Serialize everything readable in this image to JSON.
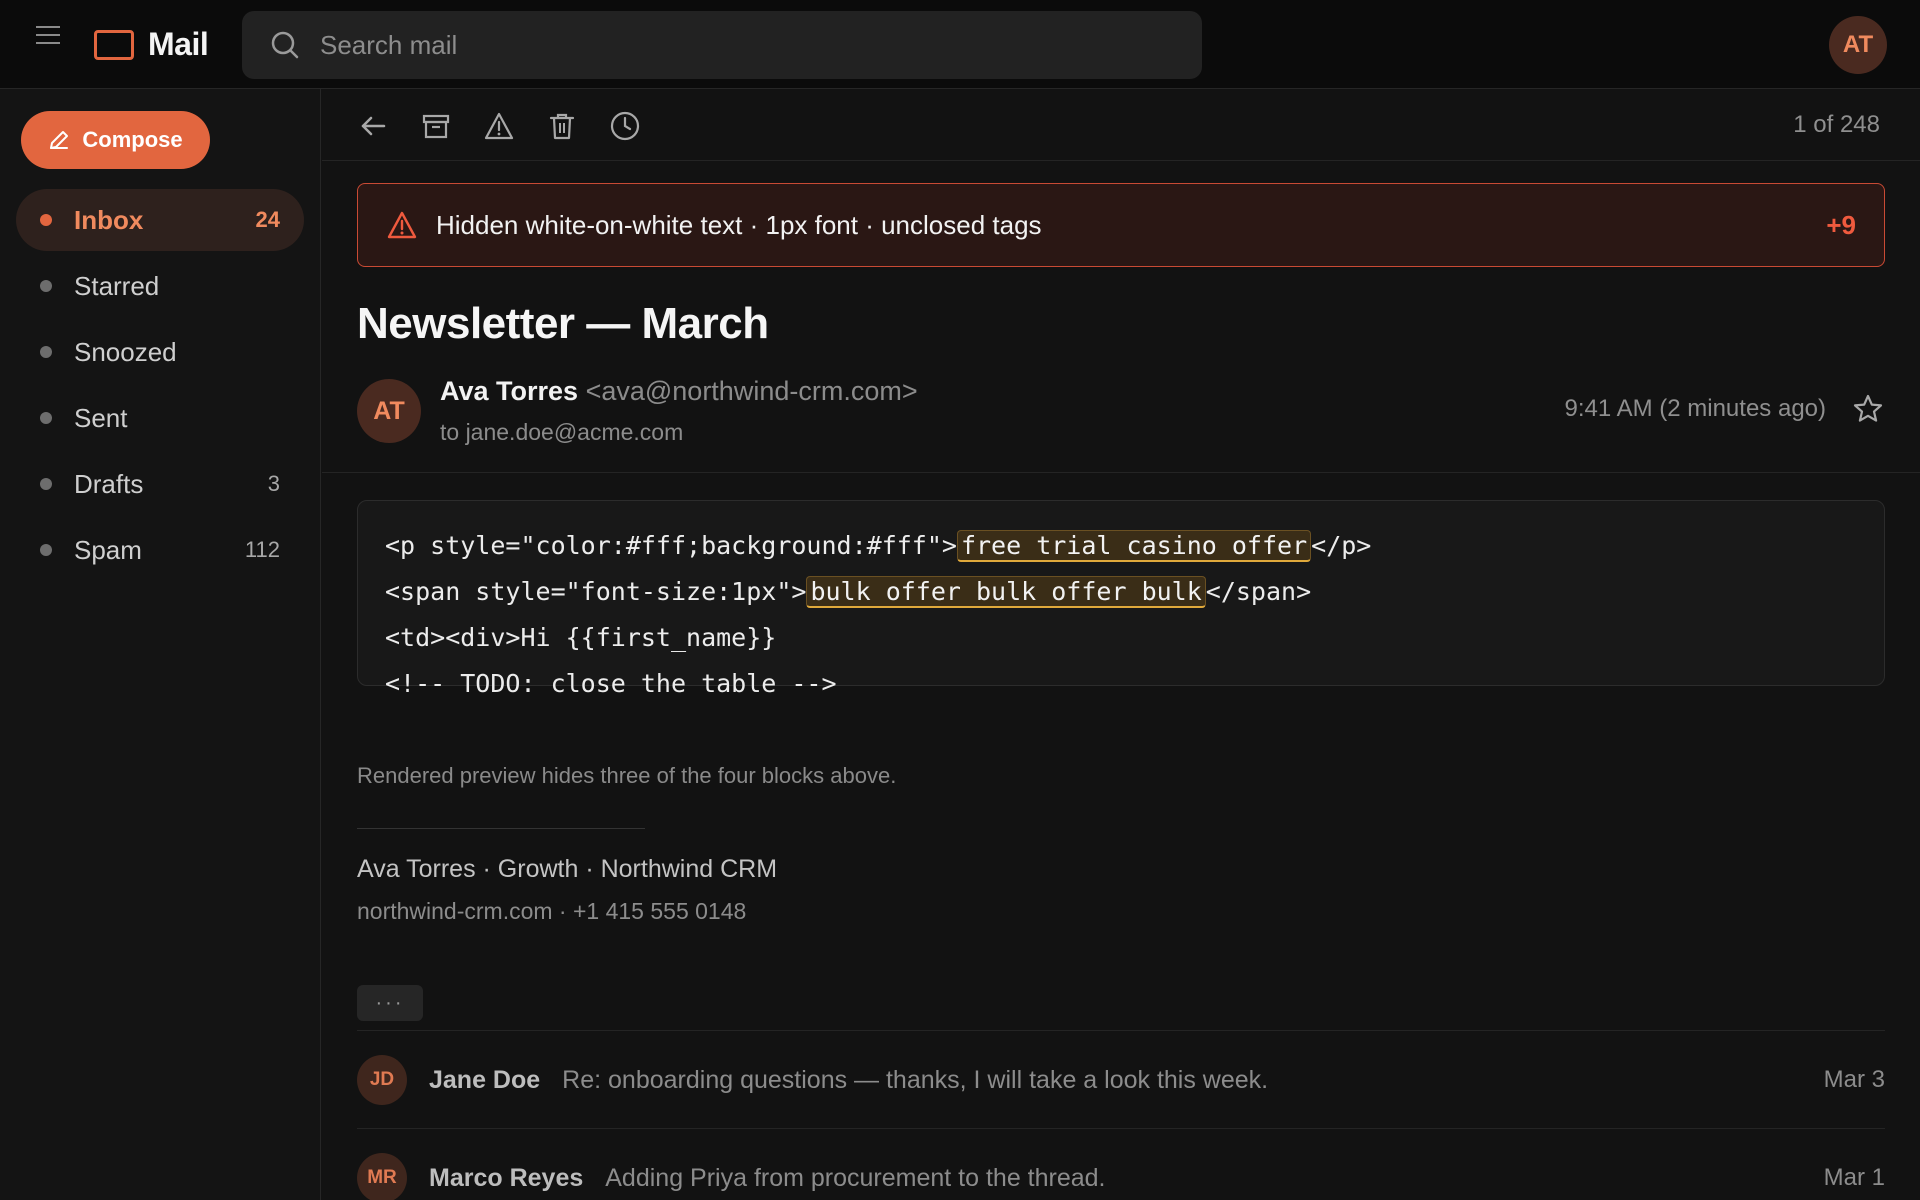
{
  "topbar": {
    "app_name": "Mail",
    "search_placeholder": "Search mail",
    "user_initials": "AT"
  },
  "sidebar": {
    "compose_label": "Compose",
    "items": [
      {
        "label": "Inbox",
        "count": "24",
        "active": true
      },
      {
        "label": "Starred",
        "count": ""
      },
      {
        "label": "Snoozed",
        "count": ""
      },
      {
        "label": "Sent",
        "count": ""
      },
      {
        "label": "Drafts",
        "count": "3"
      },
      {
        "label": "Spam",
        "count": "112"
      }
    ]
  },
  "toolbar": {
    "icons": [
      "back-arrow-icon",
      "archive-icon",
      "report-icon",
      "trash-icon",
      "snooze-clock-icon"
    ],
    "pager": "1 of 248"
  },
  "alert": {
    "text": "Hidden white-on-white text · 1px font · unclosed tags",
    "more": "+9",
    "color": "#c94a34"
  },
  "message": {
    "subject": "Newsletter — March",
    "sender_initials": "AT",
    "sender_name": "Ava Torres",
    "sender_email": "<ava@northwind-crm.com>",
    "recipient": "to jane.doe@acme.com",
    "time": "9:41 AM (2 minutes ago)",
    "code": {
      "line1_pre": "<p style=\"color:#fff;background:#fff\">",
      "line1_hl": "free trial casino offer",
      "line1_post": "</p>",
      "line2_pre": "<span style=\"font-size:1px\">",
      "line2_hl": "bulk offer bulk offer bulk",
      "line2_post": "</span>",
      "line3": "<td><div>Hi {{first_name}}",
      "line4": "<!-- TODO: close the table -->"
    },
    "note": "Rendered preview hides three of the four blocks above.",
    "signature_line1": "Ava Torres · Growth · Northwind CRM",
    "signature_line2": "northwind-crm.com · +1 415 555 0148",
    "more_label": "···"
  },
  "thread": [
    {
      "initials": "JD",
      "name": "Jane Doe",
      "snippet": "Re: onboarding questions — thanks, I will take a look this week.",
      "date": "Mar 3"
    },
    {
      "initials": "MR",
      "name": "Marco Reyes",
      "snippet": "Adding Priya from procurement to the thread.",
      "date": "Mar 1"
    }
  ],
  "colors": {
    "accent": "#e2663f",
    "background": "#121212",
    "highlight_underline": "#e0a93b"
  }
}
